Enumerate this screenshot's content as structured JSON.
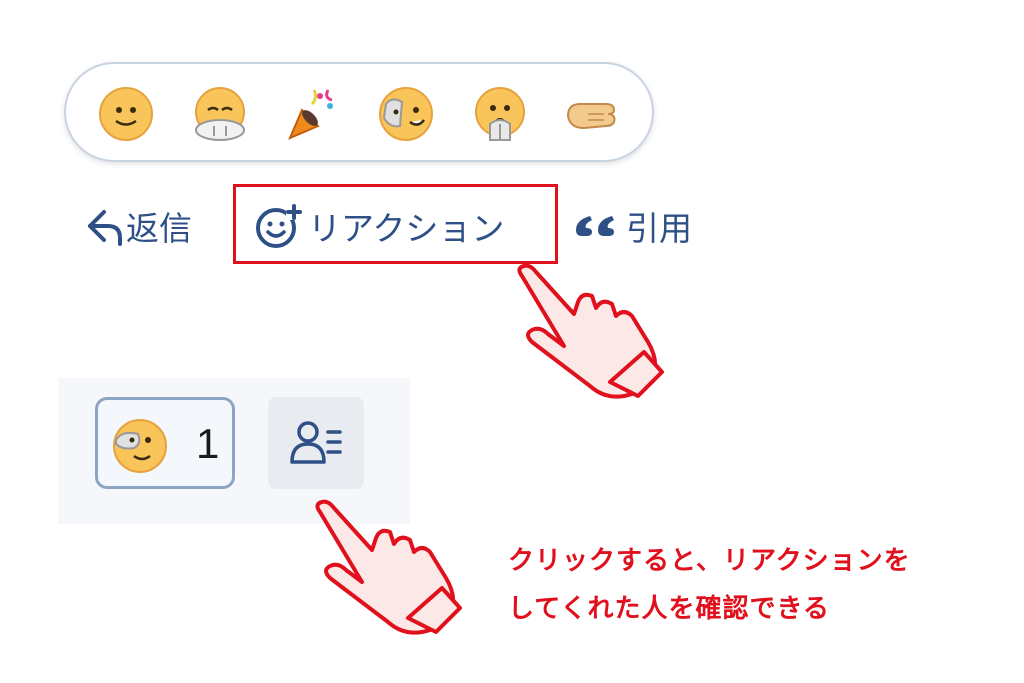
{
  "reaction_picker": {
    "emojis": [
      {
        "icon": "smile-face-icon"
      },
      {
        "icon": "crying-face-icon"
      },
      {
        "icon": "party-popper-icon"
      },
      {
        "icon": "smirk-face-icon"
      },
      {
        "icon": "surprised-face-icon"
      },
      {
        "icon": "pointing-hand-icon"
      }
    ]
  },
  "actions": {
    "reply_label": "返信",
    "reaction_label": "リアクション",
    "quote_label": "引用"
  },
  "reactions": {
    "count": "1"
  },
  "annotation": {
    "line1": "クリックすると、リアクションを",
    "line2": "してくれた人を確認できる"
  },
  "colors": {
    "action_text": "#2f4f87",
    "highlight": "#e0101c",
    "chip_border": "#8da5c4"
  }
}
